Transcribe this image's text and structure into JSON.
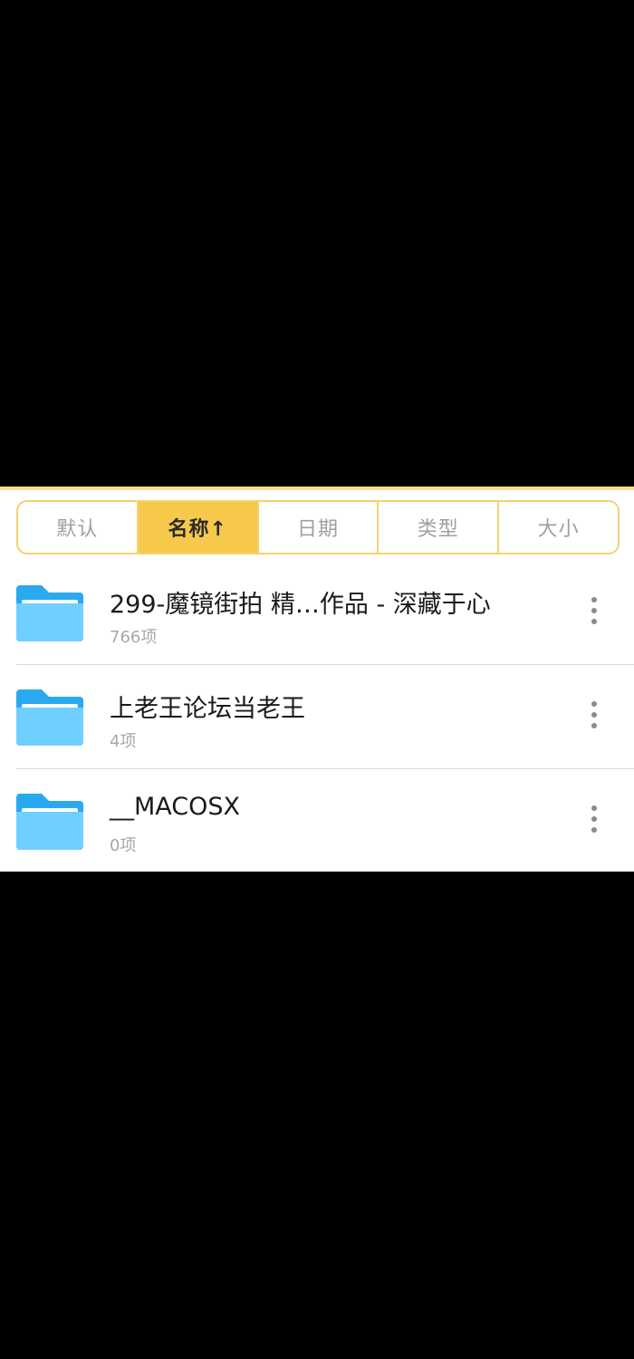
{
  "sort_bar": {
    "options": [
      {
        "label": "默认"
      },
      {
        "label": "名称↑"
      },
      {
        "label": "日期"
      },
      {
        "label": "类型"
      },
      {
        "label": "大小"
      }
    ],
    "selected": "名称↑"
  },
  "files": [
    {
      "name": "299-魔镜街拍 精…作品 - 深藏于心",
      "meta": "766项",
      "icon": "folder-icon"
    },
    {
      "name": "上老王论坛当老王",
      "meta": "4项",
      "icon": "folder-icon"
    },
    {
      "name": "__MACOSX",
      "meta": "0项",
      "icon": "folder-icon"
    }
  ],
  "colors": {
    "accent": "#f6c94c",
    "accent_border": "#f4d36d",
    "folder_back": "#29a9f0",
    "folder_front": "#6fd0ff"
  }
}
